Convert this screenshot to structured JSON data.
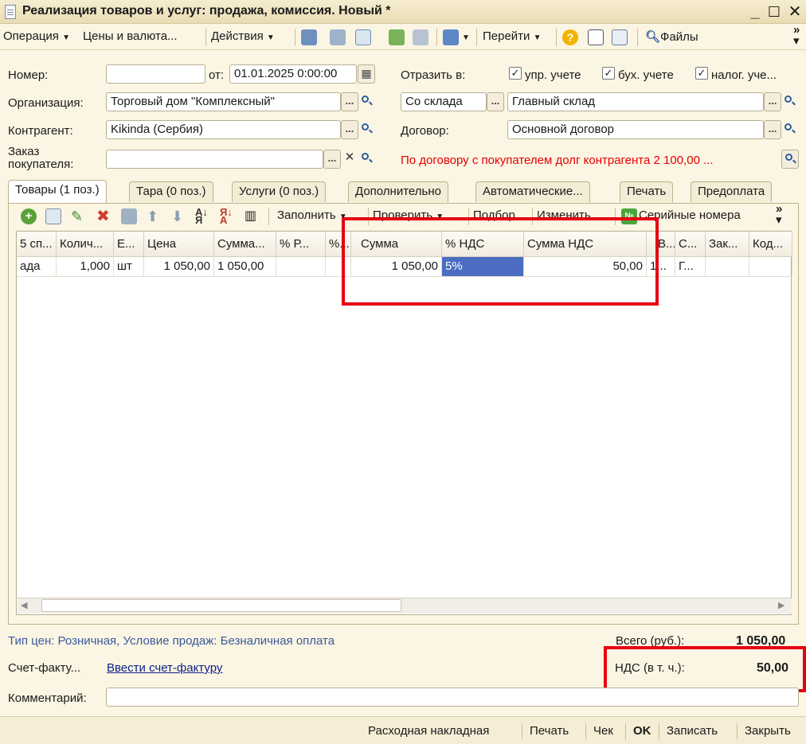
{
  "window": {
    "title": "Реализация товаров и услуг: продажа, комиссия. Новый *"
  },
  "toolbar": {
    "operation": "Операция",
    "prices": "Цены и валюта...",
    "actions": "Действия",
    "goto": "Перейти",
    "files": "Файлы"
  },
  "header": {
    "number_label": "Номер:",
    "number_value": "",
    "date_label": "от:",
    "date_value": "01.01.2025  0:00:00",
    "reflect_label": "Отразить в:",
    "reflect_mgmt": "упр. учете",
    "reflect_acc": "бух. учете",
    "reflect_tax": "налог. уче...",
    "org_label": "Организация:",
    "org_value": "Торговый дом \"Комплексный\"",
    "from_warehouse": "Со склада",
    "warehouse_value": "Главный склад",
    "counterparty_label": "Контрагент:",
    "counterparty_value": "Kikinda (Сербия)",
    "contract_label": "Договор:",
    "contract_value": "Основной договор",
    "order_label_1": "Заказ",
    "order_label_2": "покупателя:",
    "order_value": "",
    "debt_notice": "По договору с покупателем долг контрагента 2 100,00 ..."
  },
  "tabs": [
    "Товары (1 поз.)",
    "Тара (0 поз.)",
    "Услуги (0 поз.)",
    "Дополнительно",
    "Автоматические...",
    "Печать",
    "Предоплата"
  ],
  "grid_toolbar": {
    "fill": "Заполнить",
    "check": "Проверить",
    "pick": "Подбор",
    "change": "Изменить",
    "serials": "Серийные номера"
  },
  "grid": {
    "columns": [
      "5 сп...",
      "Колич...",
      "Е...",
      "Цена",
      "Сумма...",
      "% Р...",
      "%...",
      "Сумма",
      "% НДС",
      "Сумма НДС",
      "В...",
      "С...",
      "Зак...",
      "Код..."
    ],
    "rows": [
      [
        "ада",
        "1,000",
        "шт",
        "1 050,00",
        "1 050,00",
        "",
        "",
        "1 050,00",
        "5%",
        "50,00",
        "1...",
        "Г...",
        "",
        ""
      ]
    ]
  },
  "footer": {
    "price_info": "Тип цен: Розничная, Условие продаж: Безналичная оплата",
    "total_label": "Всего (руб.):",
    "total_value": "1 050,00",
    "invoice_label": "Счет-факту...",
    "invoice_link": "Ввести счет-фактуру",
    "vat_label": "НДС (в т. ч.):",
    "vat_value": "50,00",
    "comment_label": "Комментарий:",
    "comment_value": ""
  },
  "bottom_buttons": {
    "waybill": "Расходная накладная",
    "print": "Печать",
    "receipt": "Чек",
    "ok": "OK",
    "save": "Записать",
    "close": "Закрыть"
  }
}
